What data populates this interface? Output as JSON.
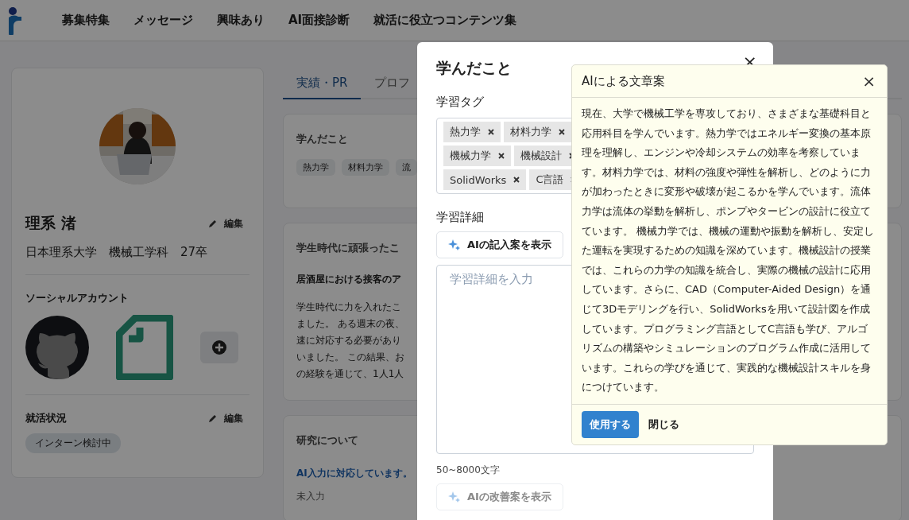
{
  "header": {
    "nav": [
      "募集特集",
      "メッセージ",
      "興味あり",
      "AI面接診断",
      "就活に役立つコンテンツ集"
    ]
  },
  "profile": {
    "name": "理系 渚",
    "edit": "編集",
    "affiliation": "日本理系大学　機械工学科　27卒",
    "social_title": "ソーシャルアカウント",
    "status_title": "就活状況",
    "status_edit": "編集",
    "status_chip": "インターン検討中"
  },
  "tabs": [
    {
      "label": "実績・PR",
      "selected": true
    },
    {
      "label": "プロフ",
      "selected": false
    }
  ],
  "cards": [
    {
      "kind": "tags",
      "title": "学んだこと",
      "tags": [
        "熱力学",
        "材料力学",
        "流"
      ]
    },
    {
      "kind": "text",
      "title": "学生時代に頑張ったこ",
      "heading": "居酒屋における接客のア",
      "lines": [
        "学生時代に力を入れたこ",
        "ました。 ある週末の夜、",
        "速に対応する必要があり",
        "いました。 この結果、お",
        "の経験を通じて、1人1人"
      ]
    },
    {
      "kind": "ai",
      "title": "研究について",
      "notice": "AI入力に対応しています。",
      "value": "未入力"
    }
  ],
  "modal": {
    "title": "学んだこと",
    "close": "×",
    "tags_label": "学習タグ",
    "tag_rows": [
      [
        {
          "label": "熱力学"
        },
        {
          "label": "材料力学"
        }
      ],
      [
        {
          "label": "機械力学"
        },
        {
          "label": "機械設計"
        }
      ],
      [
        {
          "label": "SolidWorks"
        },
        {
          "label": "C言語"
        }
      ]
    ],
    "detail_label": "学習詳細",
    "ai_button": {
      "label": "AIの記入案を表示",
      "disabled": false
    },
    "detail_placeholder": "学習詳細を入力",
    "count_hint": "50~8000文字",
    "improve_button": {
      "label": "AIの改善案を表示",
      "disabled": true
    }
  },
  "popover": {
    "title": "AIによる文章案",
    "close": "×",
    "body": "現在、大学で機械工学を専攻しており、さまざまな基礎科目と応用科目を学んでいます。熱力学ではエネルギー変換の基本原理を理解し、エンジンや冷却システムの効率を考察しています。材料力学では、材料の強度や弾性を解析し、どのように力が加わったときに変形や破壊が起こるかを学んでいます。流体力学は流体の挙動を解析し、ポンプやタービンの設計に役立てています。 機械力学では、機械の運動や振動を解析し、安定した運転を実現するための知識を深めています。機械設計の授業では、これらの力学の知識を統合し、実際の機械の設計に応用しています。さらに、CAD（Computer-Aided Design）を通じて3Dモデリングを行い、SolidWorksを用いて設計図を作成しています。プログラミング言語としてC言語も学び、アルゴリズムの構築やシミュレーションのプログラム作成に活用しています。これらの学びを通じて、実践的な機械設計スキルを身につけています。",
    "use": "使用する",
    "dismiss": "閉じる"
  }
}
